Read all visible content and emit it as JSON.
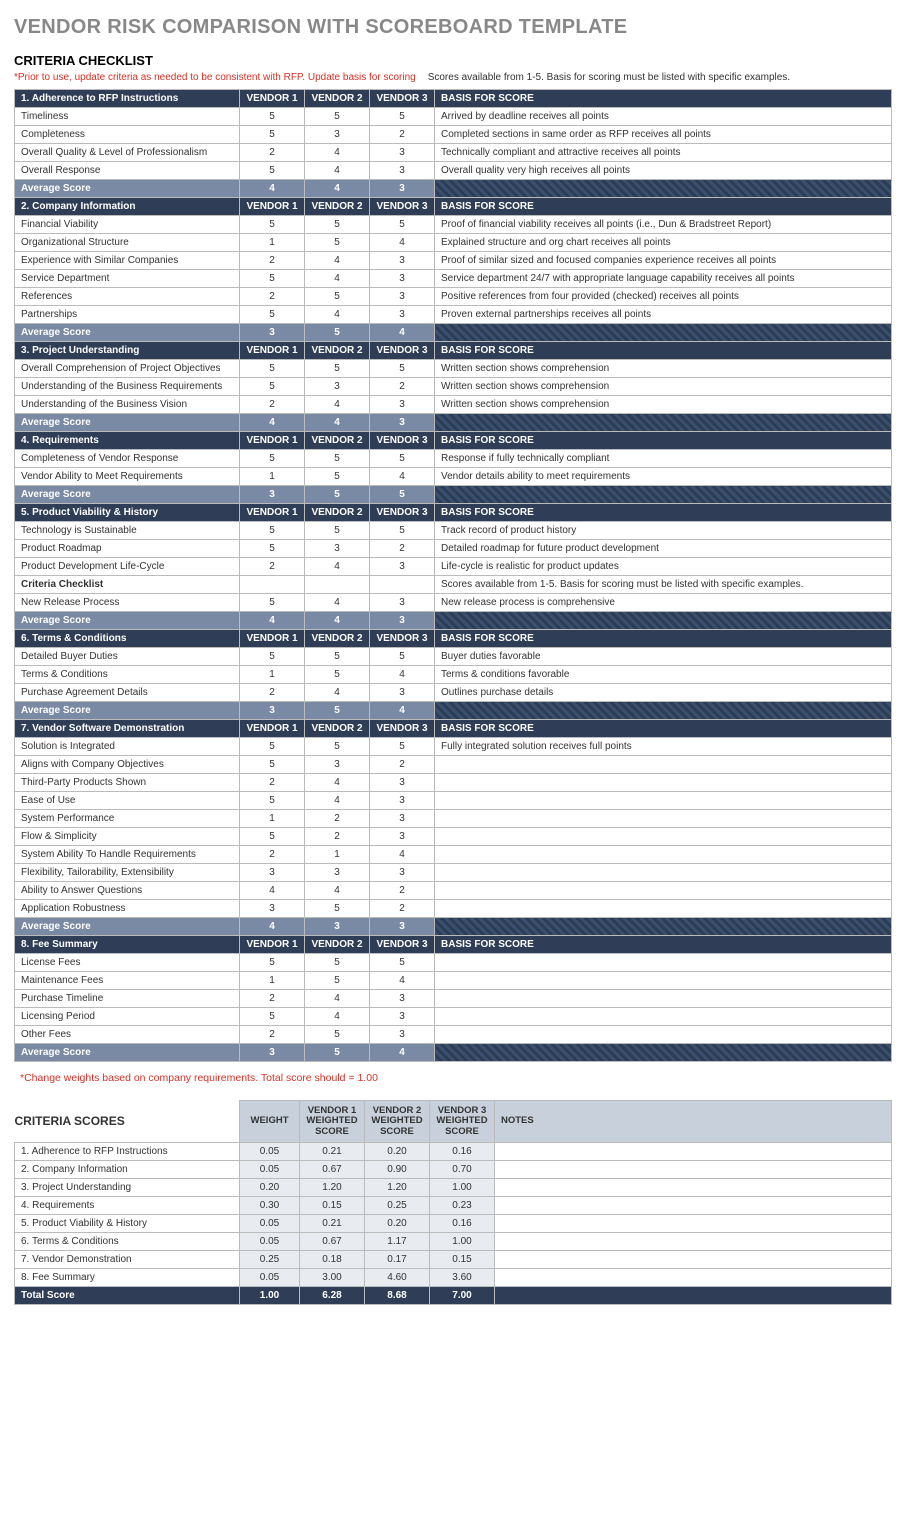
{
  "page_title": "VENDOR RISK COMPARISON WITH SCOREBOARD TEMPLATE",
  "criteria_checklist_title": "CRITERIA CHECKLIST",
  "usage_note": "*Prior to use, update criteria as needed to be consistent with RFP. Update basis for scoring",
  "scores_note": "Scores available from 1-5. Basis for scoring must be listed with specific examples.",
  "vendor_headers": [
    "VENDOR 1",
    "VENDOR 2",
    "VENDOR 3"
  ],
  "basis_header": "BASIS FOR SCORE",
  "average_label": "Average Score",
  "sections": [
    {
      "title": "1. Adherence to RFP Instructions",
      "rows": [
        {
          "c": "Timeliness",
          "v": [
            "5",
            "5",
            "5"
          ],
          "b": "Arrived by deadline receives all points"
        },
        {
          "c": "Completeness",
          "v": [
            "5",
            "3",
            "2"
          ],
          "b": "Completed sections in same order as RFP receives all points"
        },
        {
          "c": "Overall Quality & Level of Professionalism",
          "v": [
            "2",
            "4",
            "3"
          ],
          "b": "Technically compliant and attractive receives all points"
        },
        {
          "c": "Overall Response",
          "v": [
            "5",
            "4",
            "3"
          ],
          "b": "Overall quality very high receives all points"
        }
      ],
      "avg": [
        "4",
        "4",
        "3"
      ]
    },
    {
      "title": "2. Company Information",
      "rows": [
        {
          "c": "Financial Viability",
          "v": [
            "5",
            "5",
            "5"
          ],
          "b": "Proof of financial viability receives all points (i.e., Dun & Bradstreet Report)"
        },
        {
          "c": "Organizational Structure",
          "v": [
            "1",
            "5",
            "4"
          ],
          "b": "Explained structure and org chart receives all points"
        },
        {
          "c": "Experience with Similar Companies",
          "v": [
            "2",
            "4",
            "3"
          ],
          "b": "Proof of similar sized and focused companies experience receives all points"
        },
        {
          "c": "Service Department",
          "v": [
            "5",
            "4",
            "3"
          ],
          "b": "Service department 24/7 with appropriate language capability receives all points"
        },
        {
          "c": "References",
          "v": [
            "2",
            "5",
            "3"
          ],
          "b": "Positive references from four provided (checked) receives all points"
        },
        {
          "c": "Partnerships",
          "v": [
            "5",
            "4",
            "3"
          ],
          "b": "Proven external partnerships receives all points"
        }
      ],
      "avg": [
        "3",
        "5",
        "4"
      ]
    },
    {
      "title": "3. Project Understanding",
      "rows": [
        {
          "c": "Overall Comprehension of Project Objectives",
          "v": [
            "5",
            "5",
            "5"
          ],
          "b": "Written section shows comprehension"
        },
        {
          "c": "Understanding of the Business Requirements",
          "v": [
            "5",
            "3",
            "2"
          ],
          "b": "Written section shows comprehension"
        },
        {
          "c": "Understanding of the Business Vision",
          "v": [
            "2",
            "4",
            "3"
          ],
          "b": "Written section shows comprehension"
        }
      ],
      "avg": [
        "4",
        "4",
        "3"
      ]
    },
    {
      "title": "4. Requirements",
      "rows": [
        {
          "c": "Completeness of Vendor Response",
          "v": [
            "5",
            "5",
            "5"
          ],
          "b": "Response if fully technically compliant"
        },
        {
          "c": "Vendor Ability to Meet Requirements",
          "v": [
            "1",
            "5",
            "4"
          ],
          "b": "Vendor details ability to meet requirements"
        }
      ],
      "avg": [
        "3",
        "5",
        "5"
      ]
    },
    {
      "title": "5. Product Viability & History",
      "rows": [
        {
          "c": "Technology is Sustainable",
          "v": [
            "5",
            "5",
            "5"
          ],
          "b": "Track record of product history"
        },
        {
          "c": "Product Roadmap",
          "v": [
            "5",
            "3",
            "2"
          ],
          "b": "Detailed roadmap for future product development"
        },
        {
          "c": "Product Development Life-Cycle",
          "v": [
            "2",
            "4",
            "3"
          ],
          "b": "Life-cycle is realistic for product updates"
        },
        {
          "c": "Criteria Checklist",
          "v": [
            "",
            "",
            ""
          ],
          "b": "Scores available from 1-5. Basis for scoring must be listed with specific examples.",
          "bold": true
        },
        {
          "c": "New Release Process",
          "v": [
            "5",
            "4",
            "3"
          ],
          "b": "New release process is comprehensive"
        }
      ],
      "avg": [
        "4",
        "4",
        "3"
      ]
    },
    {
      "title": "6. Terms & Conditions",
      "rows": [
        {
          "c": "Detailed Buyer Duties",
          "v": [
            "5",
            "5",
            "5"
          ],
          "b": "Buyer duties favorable"
        },
        {
          "c": "Terms & Conditions",
          "v": [
            "1",
            "5",
            "4"
          ],
          "b": "Terms & conditions favorable"
        },
        {
          "c": "Purchase Agreement Details",
          "v": [
            "2",
            "4",
            "3"
          ],
          "b": "Outlines purchase details"
        }
      ],
      "avg": [
        "3",
        "5",
        "4"
      ]
    },
    {
      "title": "7. Vendor Software Demonstration",
      "rows": [
        {
          "c": "Solution is Integrated",
          "v": [
            "5",
            "5",
            "5"
          ],
          "b": "Fully integrated solution receives full points"
        },
        {
          "c": "Aligns with Company Objectives",
          "v": [
            "5",
            "3",
            "2"
          ],
          "b": ""
        },
        {
          "c": "Third-Party Products Shown",
          "v": [
            "2",
            "4",
            "3"
          ],
          "b": ""
        },
        {
          "c": "Ease of Use",
          "v": [
            "5",
            "4",
            "3"
          ],
          "b": ""
        },
        {
          "c": "System Performance",
          "v": [
            "1",
            "2",
            "3"
          ],
          "b": ""
        },
        {
          "c": "Flow & Simplicity",
          "v": [
            "5",
            "2",
            "3"
          ],
          "b": ""
        },
        {
          "c": "System Ability To Handle Requirements",
          "v": [
            "2",
            "1",
            "4"
          ],
          "b": ""
        },
        {
          "c": "Flexibility, Tailorability, Extensibility",
          "v": [
            "3",
            "3",
            "3"
          ],
          "b": ""
        },
        {
          "c": "Ability to Answer Questions",
          "v": [
            "4",
            "4",
            "2"
          ],
          "b": ""
        },
        {
          "c": "Application Robustness",
          "v": [
            "3",
            "5",
            "2"
          ],
          "b": ""
        }
      ],
      "avg": [
        "4",
        "3",
        "3"
      ]
    },
    {
      "title": "8. Fee Summary",
      "rows": [
        {
          "c": "License Fees",
          "v": [
            "5",
            "5",
            "5"
          ],
          "b": ""
        },
        {
          "c": "Maintenance Fees",
          "v": [
            "1",
            "5",
            "4"
          ],
          "b": ""
        },
        {
          "c": "Purchase Timeline",
          "v": [
            "2",
            "4",
            "3"
          ],
          "b": ""
        },
        {
          "c": "Licensing Period",
          "v": [
            "5",
            "4",
            "3"
          ],
          "b": ""
        },
        {
          "c": "Other Fees",
          "v": [
            "2",
            "5",
            "3"
          ],
          "b": ""
        }
      ],
      "avg": [
        "3",
        "5",
        "4"
      ]
    }
  ],
  "weights_note": "*Change weights based on company requirements. Total score should = 1.00",
  "scores_title": "CRITERIA SCORES",
  "scores_headers": {
    "criteria": "CRITERIA SCORES",
    "weight": "WEIGHT",
    "v1": "VENDOR 1 WEIGHTED SCORE",
    "v2": "VENDOR 2 WEIGHTED SCORE",
    "v3": "VENDOR 3 WEIGHTED SCORE",
    "notes": "NOTES"
  },
  "score_rows": [
    {
      "c": "1. Adherence to RFP Instructions",
      "w": "0.05",
      "v": [
        "0.21",
        "0.20",
        "0.16"
      ],
      "n": ""
    },
    {
      "c": "2. Company Information",
      "w": "0.05",
      "v": [
        "0.67",
        "0.90",
        "0.70"
      ],
      "n": ""
    },
    {
      "c": "3. Project Understanding",
      "w": "0.20",
      "v": [
        "1.20",
        "1.20",
        "1.00"
      ],
      "n": ""
    },
    {
      "c": "4. Requirements",
      "w": "0.30",
      "v": [
        "0.15",
        "0.25",
        "0.23"
      ],
      "n": ""
    },
    {
      "c": "5. Product Viability & History",
      "w": "0.05",
      "v": [
        "0.21",
        "0.20",
        "0.16"
      ],
      "n": ""
    },
    {
      "c": "6. Terms & Conditions",
      "w": "0.05",
      "v": [
        "0.67",
        "1.17",
        "1.00"
      ],
      "n": ""
    },
    {
      "c": "7. Vendor Demonstration",
      "w": "0.25",
      "v": [
        "0.18",
        "0.17",
        "0.15"
      ],
      "n": ""
    },
    {
      "c": "8. Fee Summary",
      "w": "0.05",
      "v": [
        "3.00",
        "4.60",
        "3.60"
      ],
      "n": ""
    }
  ],
  "total_row": {
    "label": "Total Score",
    "w": "1.00",
    "v": [
      "6.28",
      "8.68",
      "7.00"
    ]
  }
}
